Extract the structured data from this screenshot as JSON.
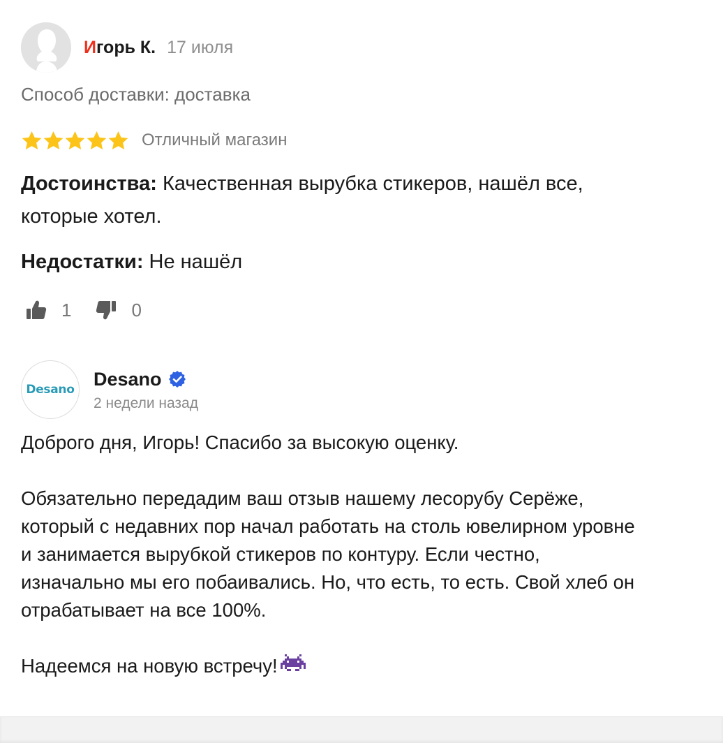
{
  "review": {
    "author_first_letter": "И",
    "author_rest": "горь К.",
    "date": "17 июля",
    "delivery": "Способ доставки: доставка",
    "rating": 5,
    "rating_max": 5,
    "rating_text": "Отличный магазин",
    "pros_label": "Достоинства:",
    "pros_text": " Качественная вырубка стикеров, нашёл все,",
    "pros_text_2": "которые хотел.",
    "cons_label": "Недостатки:",
    "cons_text": " Не нашёл",
    "likes": "1",
    "dislikes": "0",
    "star_color": "#fcc419"
  },
  "reply": {
    "shop_name": "Desano",
    "logo_text": "Desano",
    "date": "2 недели назад",
    "verified_color": "#2f62e3",
    "paragraphs": {
      "p1": "Доброго дня, Игорь! Спасибо за высокую оценку.",
      "p2_l1": "Обязательно передадим ваш отзыв нашему лесорубу Серёже,",
      "p2_l2": "который с недавних пор начал работать на столь ювелирном уровне",
      "p2_l3": "и занимается вырубкой стикеров по контуру. Если честно,",
      "p2_l4": "изначально мы его побаивались. Но, что есть, то есть. Свой хлеб он",
      "p2_l5": "отрабатывает на все 100%.",
      "p3": "Надеемся на новую встречу!"
    },
    "emoji_icon": "space-invader-icon"
  }
}
